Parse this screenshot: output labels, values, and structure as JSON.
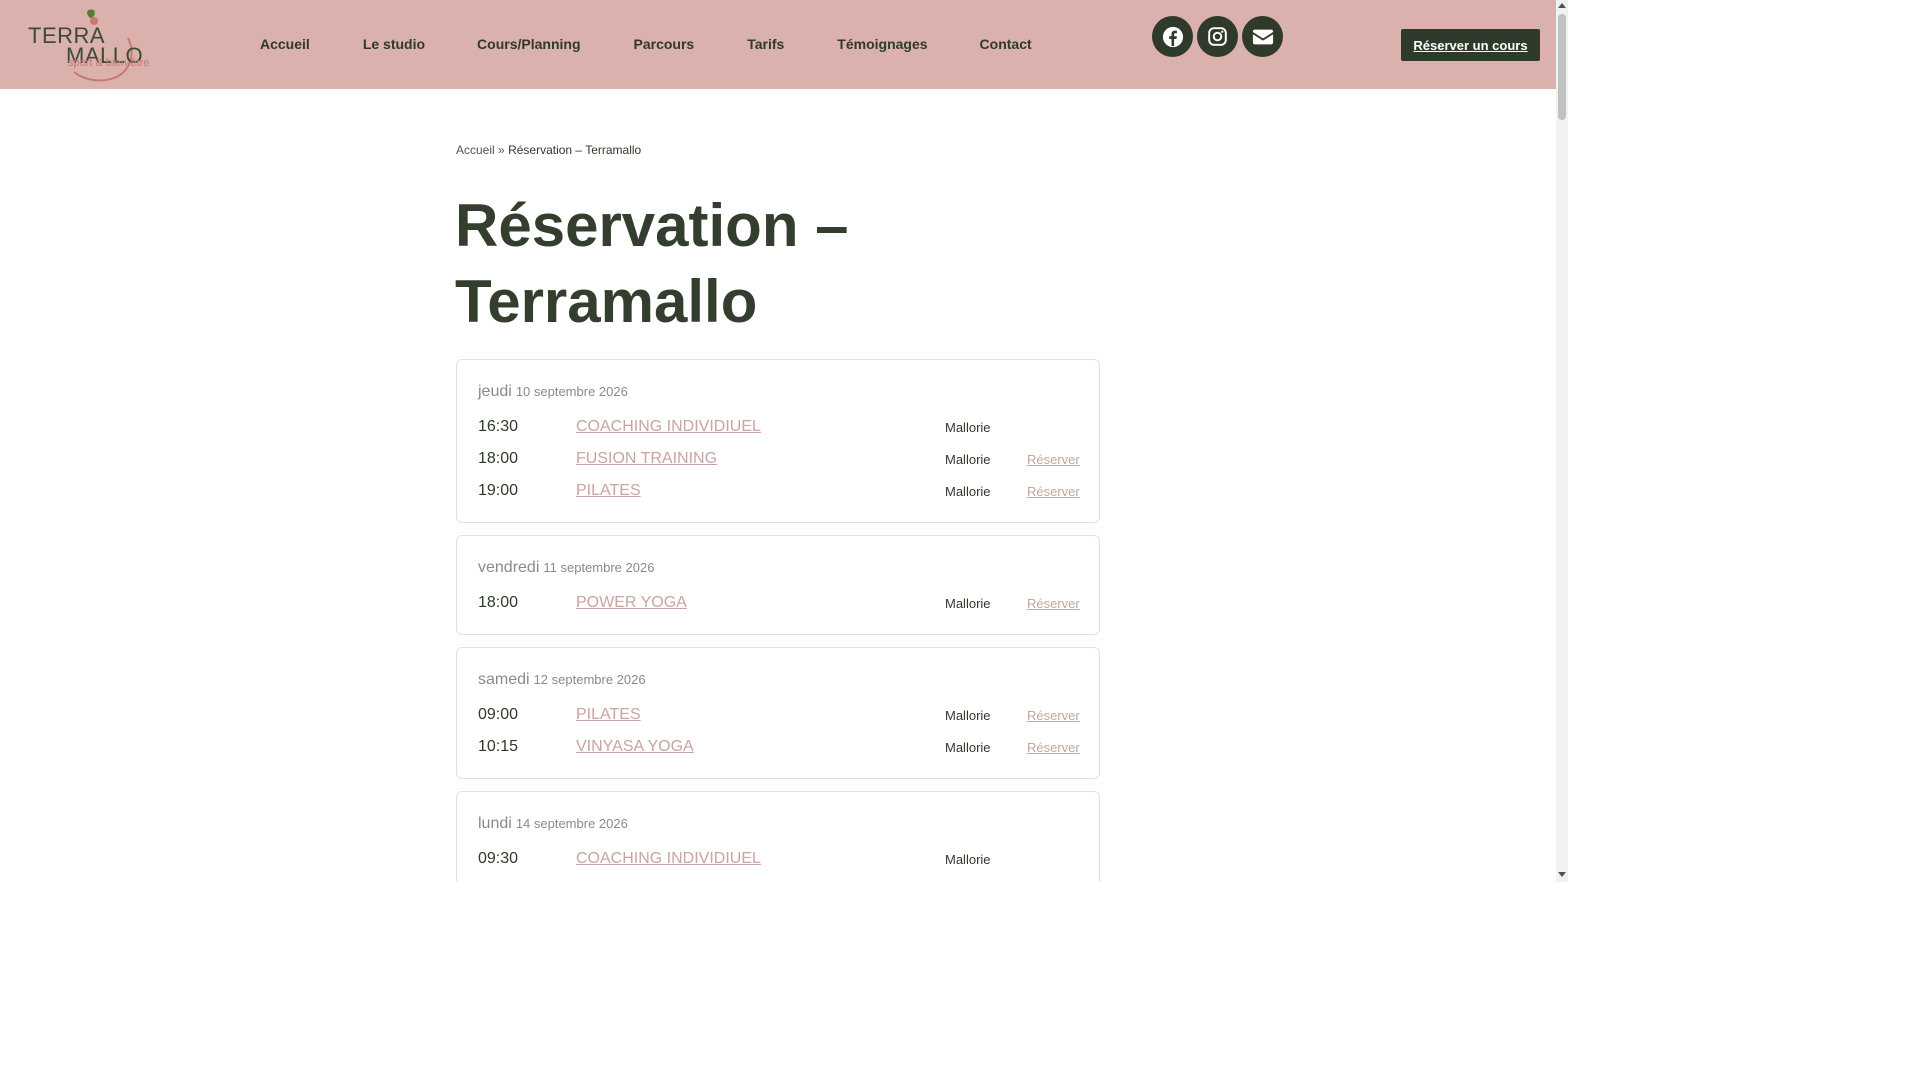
{
  "logo": {
    "line1": "TERRA",
    "line2": "MALLO",
    "tagline": "sport & bien-être"
  },
  "nav": {
    "items": [
      "Accueil",
      "Le studio",
      "Cours/Planning",
      "Parcours",
      "Tarifs",
      "Témoignages",
      "Contact"
    ]
  },
  "social": {
    "icons": [
      "facebook-icon",
      "instagram-icon",
      "mail-icon"
    ]
  },
  "header": {
    "reserve_label": "Réserver un cours"
  },
  "breadcrumb": {
    "home": "Accueil",
    "sep": "»",
    "current": "Réservation – Terramallo"
  },
  "page": {
    "title_line1": "Réservation –",
    "title_line2": "Terramallo"
  },
  "schedule": [
    {
      "day": "jeudi",
      "date": "10 septembre 2026",
      "sessions": [
        {
          "time": "16:30",
          "course": "COACHING INDIVIDIUEL",
          "teacher": "Mallorie",
          "action": ""
        },
        {
          "time": "18:00",
          "course": "FUSION TRAINING",
          "teacher": "Mallorie",
          "action": "Réserver"
        },
        {
          "time": "19:00",
          "course": "PILATES",
          "teacher": "Mallorie",
          "action": "Réserver"
        }
      ]
    },
    {
      "day": "vendredi",
      "date": "11 septembre 2026",
      "sessions": [
        {
          "time": "18:00",
          "course": "POWER YOGA",
          "teacher": "Mallorie",
          "action": "Réserver"
        }
      ]
    },
    {
      "day": "samedi",
      "date": "12 septembre 2026",
      "sessions": [
        {
          "time": "09:00",
          "course": "PILATES",
          "teacher": "Mallorie",
          "action": "Réserver"
        },
        {
          "time": "10:15",
          "course": "VINYASA YOGA",
          "teacher": "Mallorie",
          "action": "Réserver"
        }
      ]
    },
    {
      "day": "lundi",
      "date": "14 septembre 2026",
      "sessions": [
        {
          "time": "09:30",
          "course": "COACHING INDIVIDIUEL",
          "teacher": "Mallorie",
          "action": ""
        }
      ]
    }
  ],
  "colors": {
    "header_bg": "#dbb1ad",
    "primary_dark": "#2f3a2a",
    "link_pink": "#c8a4a0"
  }
}
